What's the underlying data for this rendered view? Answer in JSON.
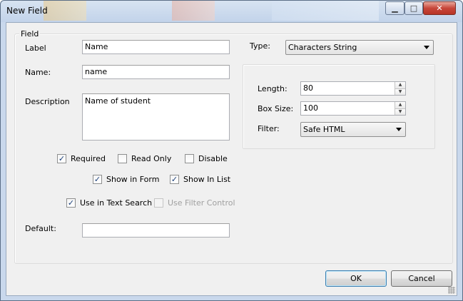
{
  "window": {
    "title": "New Field"
  },
  "group": {
    "label": "Field"
  },
  "label_field": {
    "label_text": "Label",
    "value": "Name"
  },
  "name_field": {
    "label_text": "Name:",
    "value": "name"
  },
  "description_field": {
    "label_text": "Description",
    "value": "Name of student"
  },
  "type_field": {
    "label_text": "Type:",
    "value": "Characters String"
  },
  "length_field": {
    "label_text": "Length:",
    "value": "80"
  },
  "box_size_field": {
    "label_text": "Box Size:",
    "value": "100"
  },
  "filter_field": {
    "label_text": "Filter:",
    "value": "Safe HTML"
  },
  "checkboxes": {
    "required": {
      "label": "Required",
      "checked": true
    },
    "read_only": {
      "label": "Read Only",
      "checked": false
    },
    "disable": {
      "label": "Disable",
      "checked": false
    },
    "show_in_form": {
      "label": "Show in Form",
      "checked": true
    },
    "show_in_list": {
      "label": "Show In List",
      "checked": true
    },
    "use_in_text_search": {
      "label": "Use in Text Search",
      "checked": true
    },
    "use_filter_control": {
      "label": "Use Filter Control",
      "checked": false,
      "enabled": false
    }
  },
  "default_field": {
    "label_text": "Default:",
    "value": ""
  },
  "buttons": {
    "ok": "OK",
    "cancel": "Cancel"
  }
}
